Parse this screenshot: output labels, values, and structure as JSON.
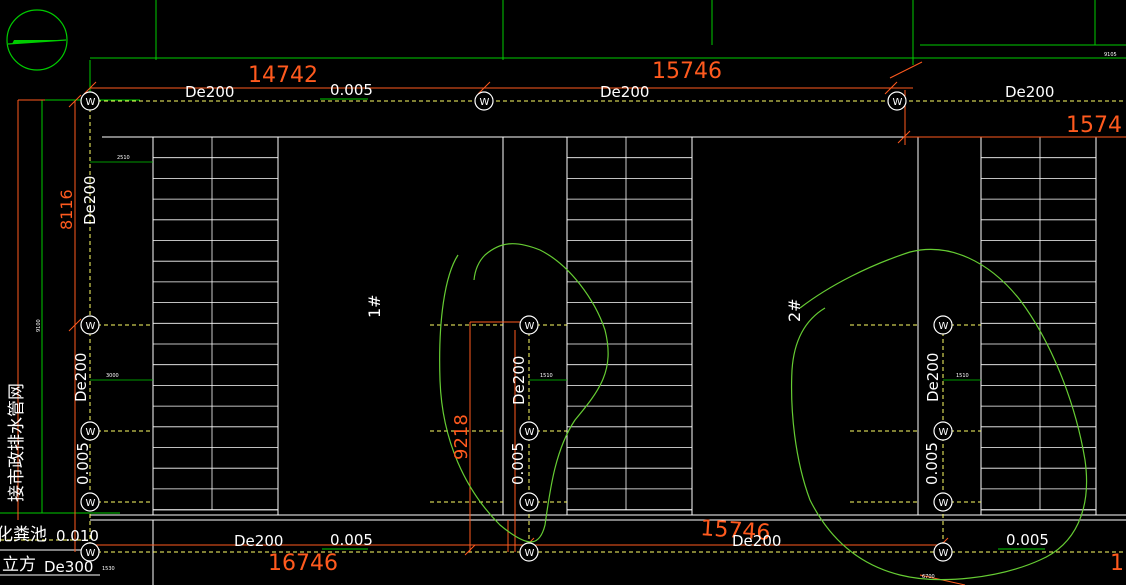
{
  "colors": {
    "background": "#000000",
    "building": "#ffffff",
    "pipe": "#ffff66",
    "dimension": "#ff5a1e",
    "grid": "#00cc00",
    "markup": "#66cc33"
  },
  "dimensions": {
    "top_left": "14742",
    "top_mid": "15746",
    "top_right": "1574",
    "bottom_left": "16746",
    "bottom_mid": "15746",
    "left_vertical": "8116",
    "mid_vertical": "9218",
    "bottom_right_edge": "1"
  },
  "pipe_labels": {
    "top_1": "De200",
    "top_2": "De200",
    "top_3": "De200",
    "left_vertical": "De200",
    "left_vertical_2": "De200",
    "mid_vertical": "De200",
    "right_vertical": "De200",
    "bottom_1": "De200",
    "bottom_2": "De200",
    "bottom_left": "De300"
  },
  "slope_labels": {
    "top": "0.005",
    "left_vertical": "0.005",
    "mid_vertical": "0.005",
    "right_vertical": "0.005",
    "bottom_1": "0.005",
    "bottom_2": "0.005",
    "left_bottom": "0.010"
  },
  "building_labels": {
    "building_1": "1#",
    "building_2": "2#"
  },
  "side_text": {
    "vertical_cn": "接市政排水管网",
    "tank": "化粪池",
    "cube": "立方"
  },
  "well_symbol": "W",
  "small_notes": {
    "n1": "2510",
    "n2": "3000",
    "n3": "1510",
    "n4": "1510",
    "n5": "9100",
    "n6": "1530",
    "n7": "6700",
    "n8": "9105"
  },
  "icons": {
    "north_arrow": "north-arrow-icon",
    "manhole": "manhole-icon"
  }
}
